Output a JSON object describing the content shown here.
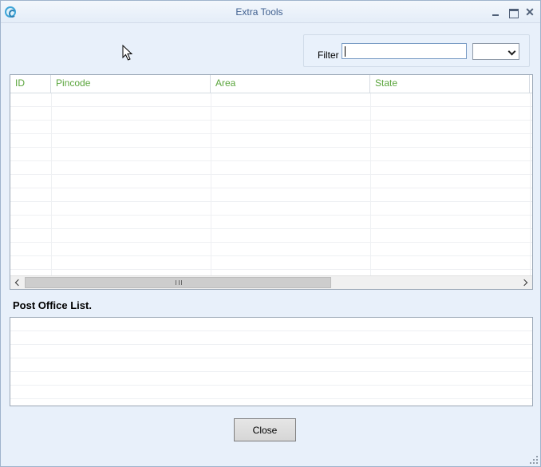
{
  "window": {
    "title": "Extra Tools"
  },
  "filter": {
    "label": "Filter",
    "value": "",
    "dropdown_value": ""
  },
  "grid": {
    "columns": [
      "ID",
      "Pincode",
      "Area",
      "State"
    ],
    "rows": []
  },
  "post_office": {
    "title": "Post Office List.",
    "items": []
  },
  "buttons": {
    "close_label": "Close"
  },
  "icons": {
    "app": "app-logo-icon",
    "minimize": "minimize-icon",
    "maximize": "maximize-icon",
    "close": "close-icon",
    "dropdown": "chevron-down-icon",
    "scroll_left": "chevron-left-icon",
    "scroll_right": "chevron-right-icon",
    "cursor": "mouse-pointer-icon",
    "resize": "resize-grip-icon"
  },
  "colors": {
    "header_text": "#5aa53c",
    "title_text": "#3f5f8f",
    "window_bg": "#e8f0fa"
  }
}
